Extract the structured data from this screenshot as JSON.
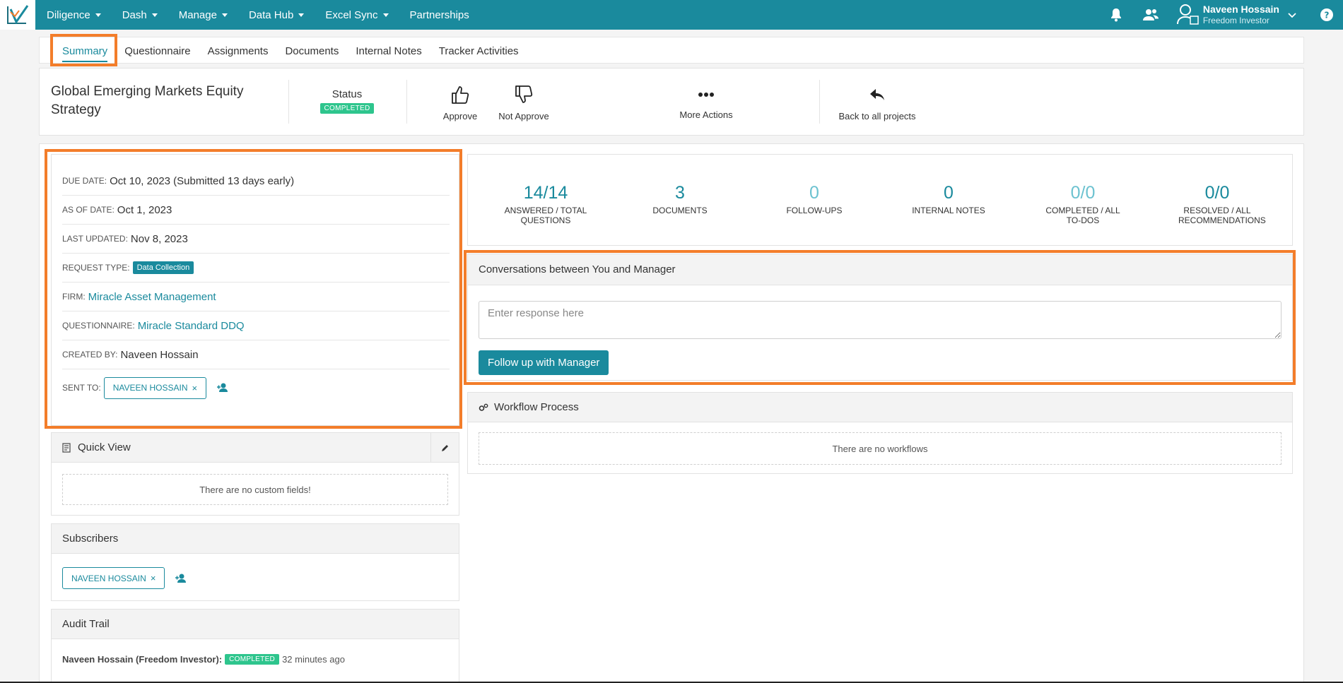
{
  "nav": {
    "items": [
      {
        "label": "Diligence",
        "caret": true
      },
      {
        "label": "Dash",
        "caret": true
      },
      {
        "label": "Manage",
        "caret": true
      },
      {
        "label": "Data Hub",
        "caret": true
      },
      {
        "label": "Excel Sync",
        "caret": true
      },
      {
        "label": "Partnerships",
        "caret": false
      }
    ],
    "user": {
      "name": "Naveen Hossain",
      "role": "Freedom Investor"
    },
    "icons": [
      "bell-icon",
      "users-icon",
      "user-profile-icon",
      "chevron-down-icon",
      "help-icon"
    ]
  },
  "tabs": [
    "Summary",
    "Questionnaire",
    "Assignments",
    "Documents",
    "Internal Notes",
    "Tracker Activities"
  ],
  "header": {
    "title": "Global Emerging Markets Equity Strategy",
    "status_label": "Status",
    "status_value": "COMPLETED",
    "approve": "Approve",
    "not_approve": "Not Approve",
    "more_actions": "More Actions",
    "back": "Back to all projects"
  },
  "details": {
    "due_date_label": "DUE DATE:",
    "due_date": "Oct 10, 2023 (Submitted 13 days early)",
    "as_of_label": "AS OF DATE:",
    "as_of": "Oct 1, 2023",
    "last_updated_label": "LAST UPDATED:",
    "last_updated": "Nov 8, 2023",
    "request_type_label": "REQUEST TYPE:",
    "request_type": "Data Collection",
    "firm_label": "FIRM:",
    "firm": "Miracle Asset Management",
    "questionnaire_label": "QUESTIONNAIRE:",
    "questionnaire": "Miracle Standard DDQ",
    "created_by_label": "CREATED BY:",
    "created_by": "Naveen Hossain",
    "sent_to_label": "SENT TO:",
    "sent_to": "NAVEEN HOSSAIN"
  },
  "quick_view": {
    "title": "Quick View",
    "empty": "There are no custom fields!"
  },
  "subscribers": {
    "title": "Subscribers",
    "chip": "NAVEEN HOSSAIN"
  },
  "audit": {
    "title": "Audit Trail",
    "who": "Naveen Hossain (Freedom Investor):",
    "status": "COMPLETED",
    "ago": "32 minutes ago"
  },
  "stats": [
    {
      "value": "14/14",
      "label": "ANSWERED / TOTAL QUESTIONS",
      "light": false
    },
    {
      "value": "3",
      "label": "DOCUMENTS",
      "light": false
    },
    {
      "value": "0",
      "label": "FOLLOW-UPS",
      "light": true
    },
    {
      "value": "0",
      "label": "INTERNAL NOTES",
      "light": false
    },
    {
      "value": "0/0",
      "label": "COMPLETED / ALL TO-DOS",
      "light": true
    },
    {
      "value": "0/0",
      "label": "RESOLVED / ALL RECOMMENDATIONS",
      "light": false
    }
  ],
  "conversation": {
    "title": "Conversations between You and Manager",
    "placeholder": "Enter response here",
    "button": "Follow up with Manager"
  },
  "workflow": {
    "title": "Workflow Process",
    "empty": "There are no workflows"
  },
  "colors": {
    "accent": "#1a8a9d",
    "highlight": "#f37d2a",
    "success": "#2ec58d"
  }
}
